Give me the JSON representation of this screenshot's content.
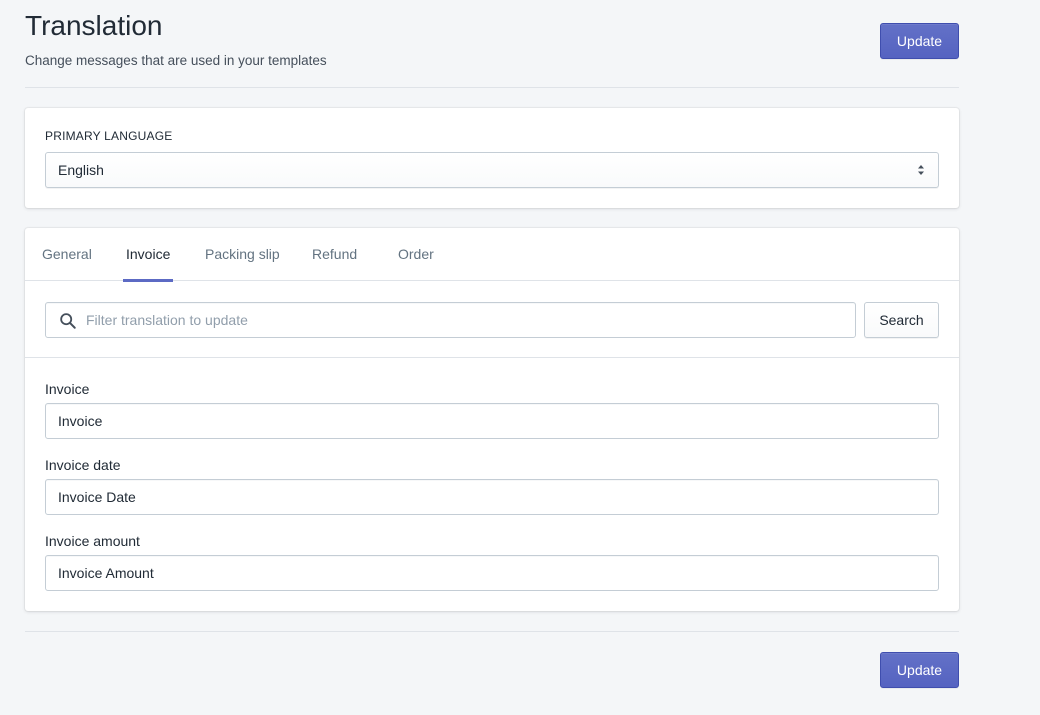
{
  "header": {
    "title": "Translation",
    "subtitle": "Change messages that are used in your templates",
    "update_label": "Update"
  },
  "language": {
    "label": "PRIMARY LANGUAGE",
    "selected": "English"
  },
  "tabs": [
    {
      "label": "General",
      "active": false
    },
    {
      "label": "Invoice",
      "active": true
    },
    {
      "label": "Packing slip",
      "active": false
    },
    {
      "label": "Refund",
      "active": false
    },
    {
      "label": "Order",
      "active": false
    }
  ],
  "search": {
    "placeholder": "Filter translation to update",
    "button_label": "Search"
  },
  "fields": [
    {
      "label": "Invoice",
      "value": "Invoice"
    },
    {
      "label": "Invoice date",
      "value": "Invoice Date"
    },
    {
      "label": "Invoice amount",
      "value": "Invoice Amount"
    }
  ],
  "footer": {
    "update_label": "Update"
  },
  "colors": {
    "accent": "#5c6ac4",
    "background": "#f4f6f8",
    "border": "#c4cdd5"
  }
}
